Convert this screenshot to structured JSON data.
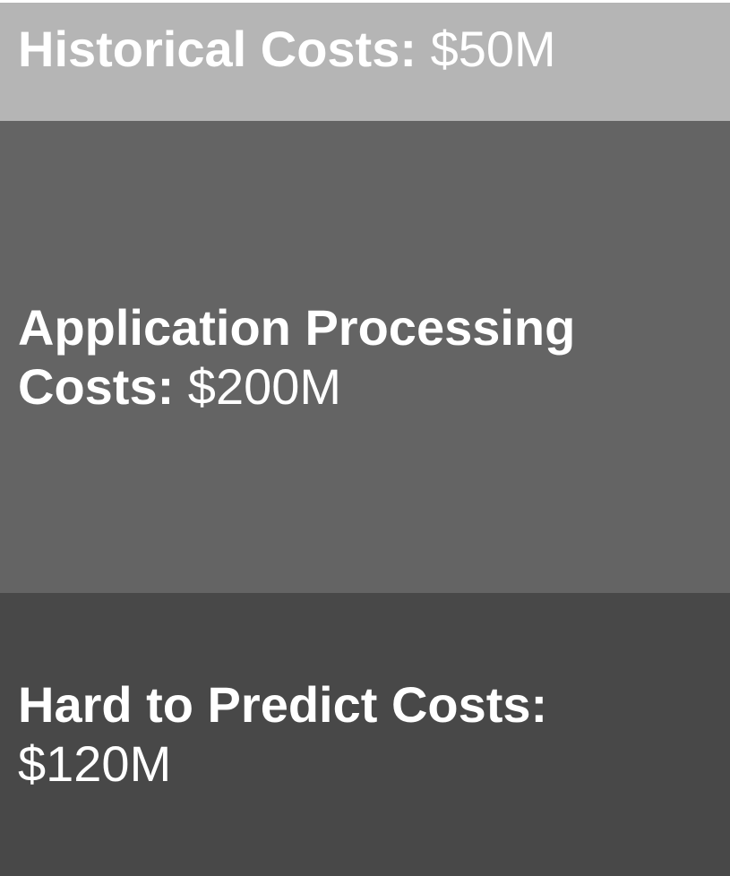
{
  "chart_data": {
    "type": "bar",
    "subtype": "stacked-proportional",
    "orientation": "vertical",
    "categories": [
      "Historical Costs",
      "Application Processing Costs",
      "Hard to Predict Costs"
    ],
    "values": [
      50,
      200,
      120
    ],
    "unit": "$M",
    "segments": [
      {
        "name": "Historical Costs:",
        "value_label": "$50M",
        "value": 50,
        "color": "#b5b5b5"
      },
      {
        "name": "Application Processing Costs:",
        "value_label": "$200M",
        "value": 200,
        "color": "#646464"
      },
      {
        "name": "Hard to Predict Costs:",
        "value_label": "$120M",
        "value": 120,
        "color": "#484848"
      }
    ],
    "title": "",
    "xlabel": "",
    "ylabel": "",
    "grid": false,
    "legend": "none"
  }
}
